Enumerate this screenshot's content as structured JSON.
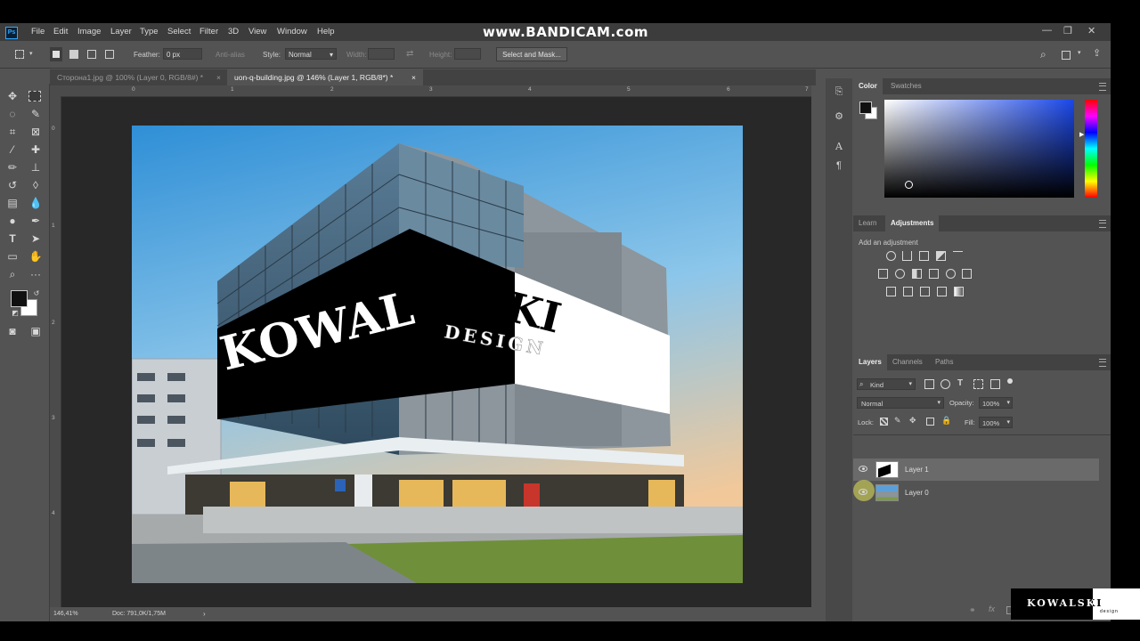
{
  "watermark": "www.BANDICAM.com",
  "menu": [
    "File",
    "Edit",
    "Image",
    "Layer",
    "Type",
    "Select",
    "Filter",
    "3D",
    "View",
    "Window",
    "Help"
  ],
  "options": {
    "feather_label": "Feather:",
    "feather_value": "0 px",
    "antialias_label": "Anti-alias",
    "style_label": "Style:",
    "style_value": "Normal",
    "width_label": "Width:",
    "height_label": "Height:",
    "select_mask_label": "Select and Mask..."
  },
  "tabs": [
    {
      "label": "Сторона1.jpg @ 100% (Layer 0, RGB/8#) *",
      "active": false
    },
    {
      "label": "uon-q-building.jpg @ 146% (Layer 1, RGB/8*) *",
      "active": true
    }
  ],
  "ruler_top": [
    "0",
    "1",
    "2",
    "3",
    "4",
    "5",
    "6",
    "7"
  ],
  "ruler_left": [
    "0",
    "1",
    "2",
    "3",
    "4"
  ],
  "status": {
    "zoom": "146,41%",
    "doc": "Doc: 791,0K/1,75M"
  },
  "color_panel": {
    "tabs": [
      "Color",
      "Swatches"
    ],
    "active": "Color",
    "hue_color": "#1a47e8"
  },
  "adjust_panel": {
    "tabs": [
      "Learn",
      "Adjustments"
    ],
    "active": "Adjustments",
    "hint": "Add an adjustment"
  },
  "layers_panel": {
    "tabs": [
      "Layers",
      "Channels",
      "Paths"
    ],
    "active": "Layers",
    "filter_kind": "Kind",
    "blend_mode": "Normal",
    "opacity_label": "Opacity:",
    "opacity_value": "100%",
    "lock_label": "Lock:",
    "fill_label": "Fill:",
    "fill_value": "100%",
    "layers": [
      {
        "name": "Layer 1",
        "selected": true,
        "visible": true
      },
      {
        "name": "Layer 0",
        "selected": false,
        "visible": true
      }
    ]
  },
  "canvas_art": {
    "banner_line1": "KOWALSKI",
    "banner_line2": "DESIGN"
  },
  "corner_logo": {
    "line1": "KOWALSKI",
    "line2": "design"
  }
}
